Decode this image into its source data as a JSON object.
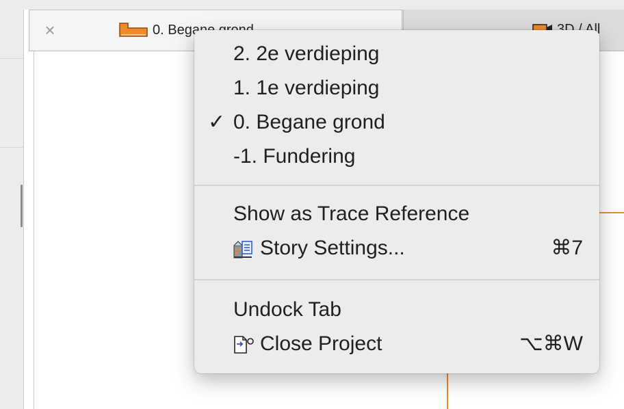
{
  "tabs": [
    {
      "label": "0. Begane grond",
      "active": true,
      "icon": "floor-plan-icon"
    },
    {
      "label": "3D / All",
      "active": false,
      "icon": "3d-camera-icon"
    }
  ],
  "menu": {
    "stories": [
      {
        "label": "2. 2e verdieping",
        "checked": false
      },
      {
        "label": "1. 1e verdieping",
        "checked": false
      },
      {
        "label": "0. Begane grond",
        "checked": true
      },
      {
        "label": "-1. Fundering",
        "checked": false
      }
    ],
    "check_mark": "✓",
    "show_trace": "Show as Trace Reference",
    "story_settings": {
      "label": "Story Settings...",
      "shortcut": "⌘7",
      "icon": "story-settings-icon"
    },
    "undock": "Undock Tab",
    "close_project": {
      "label": "Close Project",
      "shortcut": "⌥⌘W",
      "icon": "close-project-icon"
    }
  },
  "colors": {
    "floor_icon": "#f08a28",
    "guide_line": "#f08a28",
    "menu_bg": "#ececec"
  }
}
